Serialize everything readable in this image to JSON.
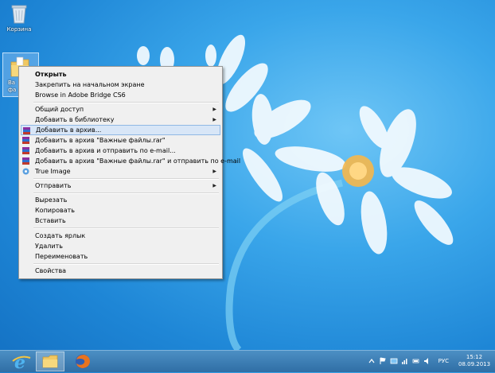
{
  "desktop": {
    "recycle_bin_label": "Корзина",
    "folder_label_line1": "Ва",
    "folder_label_line2": "фа"
  },
  "context_menu": {
    "items": [
      {
        "label": "Открыть",
        "bold": true
      },
      {
        "label": "Закрепить на начальном экране"
      },
      {
        "label": "Browse in Adobe Bridge CS6"
      },
      {
        "label": "Общий доступ",
        "submenu": true
      },
      {
        "label": "Добавить в библиотеку",
        "submenu": true
      },
      {
        "label": "Добавить в архив...",
        "highlighted": true,
        "icon": "winrar-icon"
      },
      {
        "label": "Добавить в архив \"Важные файлы.rar\"",
        "icon": "winrar-icon"
      },
      {
        "label": "Добавить в архив и отправить по e-mail...",
        "icon": "winrar-icon"
      },
      {
        "label": "Добавить в архив \"Важные файлы.rar\" и отправить по e-mail",
        "icon": "winrar-icon"
      },
      {
        "label": "True Image",
        "submenu": true,
        "icon": "true-image-icon"
      },
      {
        "label": "Отправить",
        "submenu": true
      },
      {
        "label": "Вырезать"
      },
      {
        "label": "Копировать"
      },
      {
        "label": "Вставить"
      },
      {
        "label": "Создать ярлык"
      },
      {
        "label": "Удалить"
      },
      {
        "label": "Переименовать"
      },
      {
        "label": "Свойства"
      }
    ]
  },
  "taskbar": {
    "language": "РУС",
    "time": "15:12",
    "date": "08.09.2013"
  },
  "colors": {
    "menu_highlight": "#d8e6f7",
    "taskbar": "#3b7db4"
  }
}
